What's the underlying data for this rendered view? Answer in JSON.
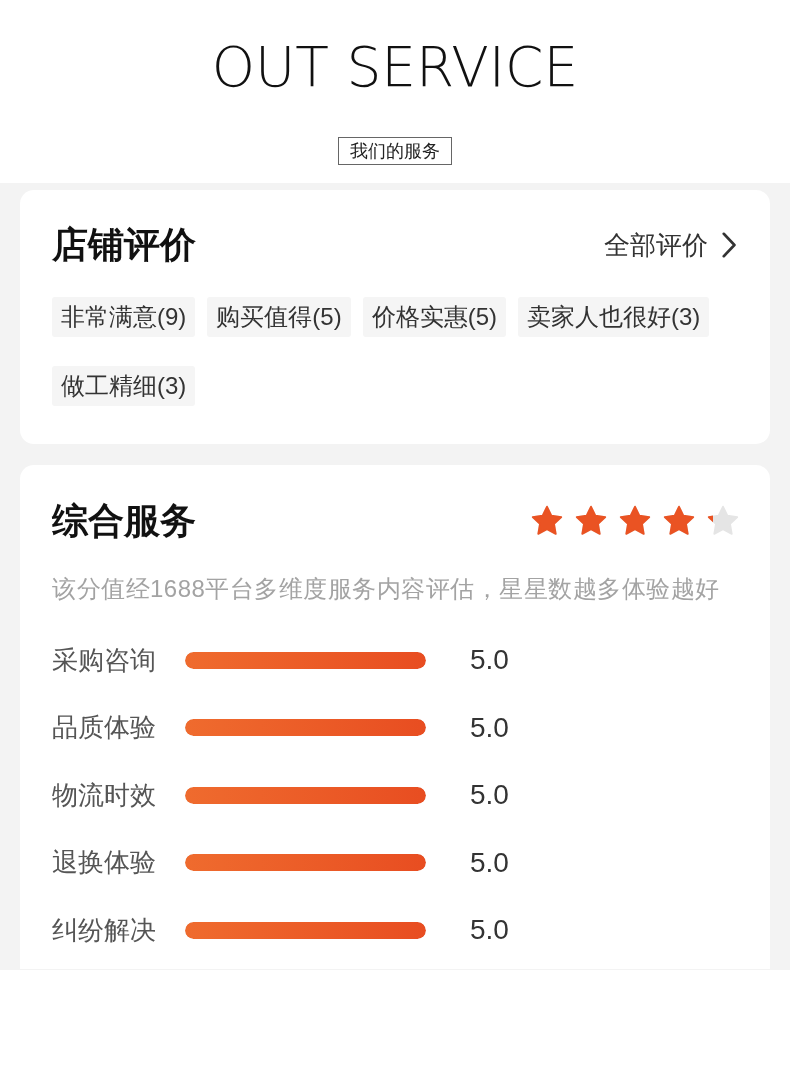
{
  "header": {
    "title": "OUT SERVICE",
    "subtitle": "我们的服务"
  },
  "store_reviews": {
    "title": "店铺评价",
    "link": "全部评价",
    "tags": [
      "非常满意(9)",
      "购买值得(5)",
      "价格实惠(5)",
      "卖家人也很好(3)",
      "做工精细(3)"
    ]
  },
  "service": {
    "title": "综合服务",
    "stars": 4.2,
    "description": "该分值经1688平台多维度服务内容评估，星星数越多体验越好",
    "metrics": [
      {
        "label": "采购咨询",
        "level": 1,
        "score": "5.0"
      },
      {
        "label": "品质体验",
        "level": 1,
        "score": "5.0"
      },
      {
        "label": "物流时效",
        "level": 1,
        "score": "5.0"
      },
      {
        "label": "退换体验",
        "level": 1,
        "score": "5.0"
      },
      {
        "label": "纠纷解决",
        "level": 1,
        "score": "5.0"
      }
    ]
  }
}
